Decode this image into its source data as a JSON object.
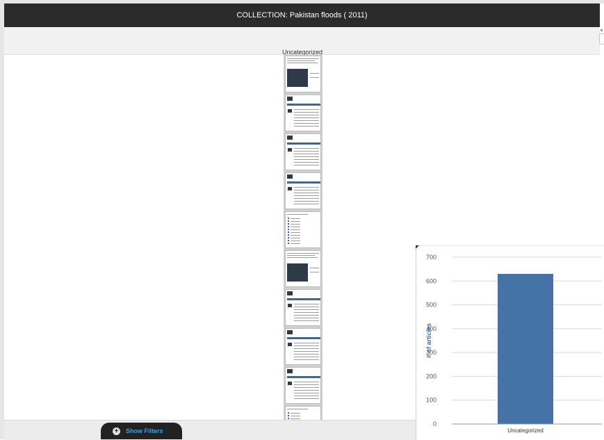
{
  "header": {
    "title": "COLLECTION: Pakistan floods ( 2011)"
  },
  "column": {
    "label": "Uncategorized",
    "thumbnail_count": 10
  },
  "filters": {
    "label": "Show Filters",
    "icon": "plus-circle-icon"
  },
  "colors": {
    "titlebar": "#2b2b2b",
    "bar": "#4572a7",
    "filter_text": "#3aa0e8"
  },
  "chart_data": {
    "type": "bar",
    "categories": [
      "Uncategorized"
    ],
    "values": [
      630
    ],
    "ylabel": "# of articles",
    "ylim": [
      0,
      700
    ],
    "yticks": [
      0,
      100,
      200,
      300,
      400,
      500,
      600,
      700
    ],
    "grid": true,
    "color": "#4572a7"
  }
}
